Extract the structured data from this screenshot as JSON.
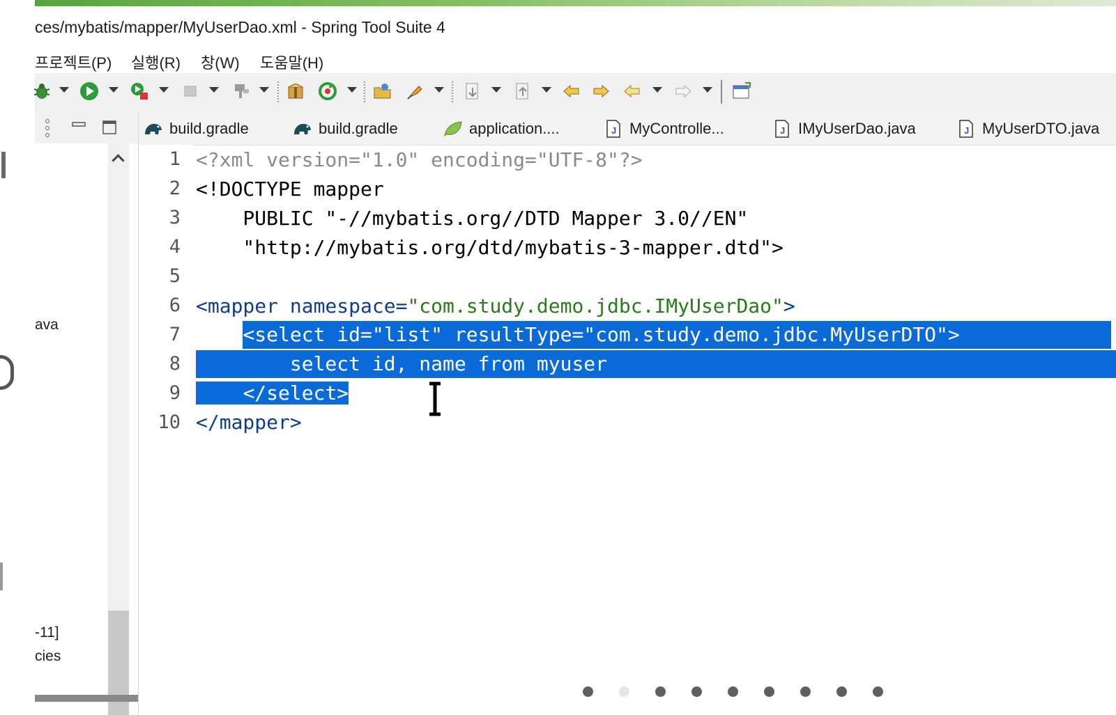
{
  "window": {
    "title": "ces/mybatis/mapper/MyUserDao.xml - Spring Tool Suite 4"
  },
  "menu": {
    "items": [
      "프로젝트(P)",
      "실행(R)",
      "창(W)",
      "도움말(H)"
    ]
  },
  "toolbar": {
    "icons": [
      "debug-icon",
      "run-icon",
      "external-run-icon",
      "stop-icon",
      "build-icon",
      "package-icon",
      "refresh-run-icon",
      "open-folder-icon",
      "pin-icon",
      "next-annotation-icon",
      "prev-annotation-icon",
      "back-edit-icon",
      "forward-edit-icon",
      "back-icon",
      "forward-icon",
      "new-window-icon"
    ]
  },
  "left_panel": {
    "partial_labels": [
      "ava",
      "-11]",
      "cies"
    ]
  },
  "tabs": [
    {
      "label": "build.gradle",
      "icon": "gradle-icon"
    },
    {
      "label": "build.gradle",
      "icon": "gradle-icon"
    },
    {
      "label": "application....",
      "icon": "spring-leaf-icon"
    },
    {
      "label": "MyControlle...",
      "icon": "java-file-icon"
    },
    {
      "label": "IMyUserDao.java",
      "icon": "java-file-icon"
    },
    {
      "label": "MyUserDTO.java",
      "icon": "java-file-icon"
    }
  ],
  "editor": {
    "line_numbers": [
      "1",
      "2",
      "3",
      "4",
      "5",
      "6",
      "7",
      "8",
      "9",
      "10"
    ],
    "lines": {
      "l1": "<?xml version=\"1.0\" encoding=\"UTF-8\"?>",
      "l2": "<!DOCTYPE mapper",
      "l3": "    PUBLIC \"-//mybatis.org//DTD Mapper 3.0//EN\"",
      "l4": "    \"http://mybatis.org/dtd/mybatis-3-mapper.dtd\">",
      "l5": "",
      "l6a": "<mapper namespace=",
      "l6b": "\"com.study.demo.jdbc.IMyUserDao\"",
      "l6c": ">",
      "l7indent": "    ",
      "l7": "<select id=\"list\" resultType=\"com.study.demo.jdbc.MyUserDTO\">",
      "l8": "        select id, name from myuser",
      "l9indent": "    ",
      "l9": "</select>",
      "l10": "</mapper>"
    }
  },
  "colors": {
    "selection": "#0a6ad8",
    "tag": "#0d3d8c",
    "string": "#2a7a1e",
    "title_accent": "#56a640"
  },
  "pager": {
    "count": 9,
    "active_index": 1
  }
}
